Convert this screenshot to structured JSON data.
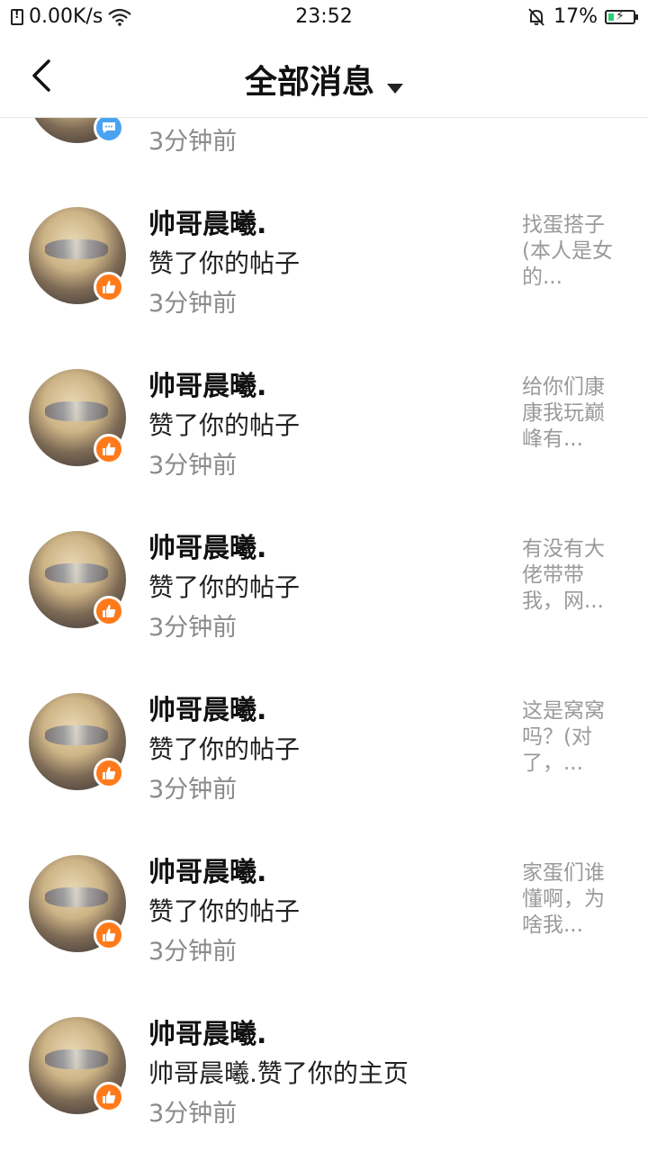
{
  "status_bar": {
    "net_speed": "0.00K/s",
    "time": "23:52",
    "battery": "17%",
    "icons": [
      "sim-alert-icon",
      "wifi-icon",
      "mute-bell-icon",
      "battery-charging-icon"
    ],
    "battery_level": 0.17
  },
  "header": {
    "title": "全部消息",
    "back_icon": "chevron-left-icon",
    "dropdown_icon": "caret-down-icon"
  },
  "colors": {
    "like_badge": "#ff7a1a",
    "comment_badge": "#4aa3f0",
    "time_text": "#8a8a8a",
    "preview_text": "#9a9a9a"
  },
  "partial_item": {
    "time": "3分钟前",
    "badge": "comment-icon"
  },
  "messages": [
    {
      "name": "帅哥晨曦.",
      "action": "赞了你的帖子",
      "time": "3分钟前",
      "preview": "找蛋搭子(本人是女的...",
      "badge": "thumbs-up-icon"
    },
    {
      "name": "帅哥晨曦.",
      "action": "赞了你的帖子",
      "time": "3分钟前",
      "preview": "给你们康康我玩巅峰有...",
      "badge": "thumbs-up-icon"
    },
    {
      "name": "帅哥晨曦.",
      "action": "赞了你的帖子",
      "time": "3分钟前",
      "preview": "有没有大佬带带我，网...",
      "badge": "thumbs-up-icon"
    },
    {
      "name": "帅哥晨曦.",
      "action": "赞了你的帖子",
      "time": "3分钟前",
      "preview": "这是窝窝吗？(对了，...",
      "badge": "thumbs-up-icon"
    },
    {
      "name": "帅哥晨曦.",
      "action": "赞了你的帖子",
      "time": "3分钟前",
      "preview": "家蛋们谁懂啊，为啥我...",
      "badge": "thumbs-up-icon"
    },
    {
      "name": "帅哥晨曦.",
      "action": "帅哥晨曦.赞了你的主页",
      "time": "3分钟前",
      "preview": "",
      "badge": "thumbs-up-icon"
    }
  ]
}
